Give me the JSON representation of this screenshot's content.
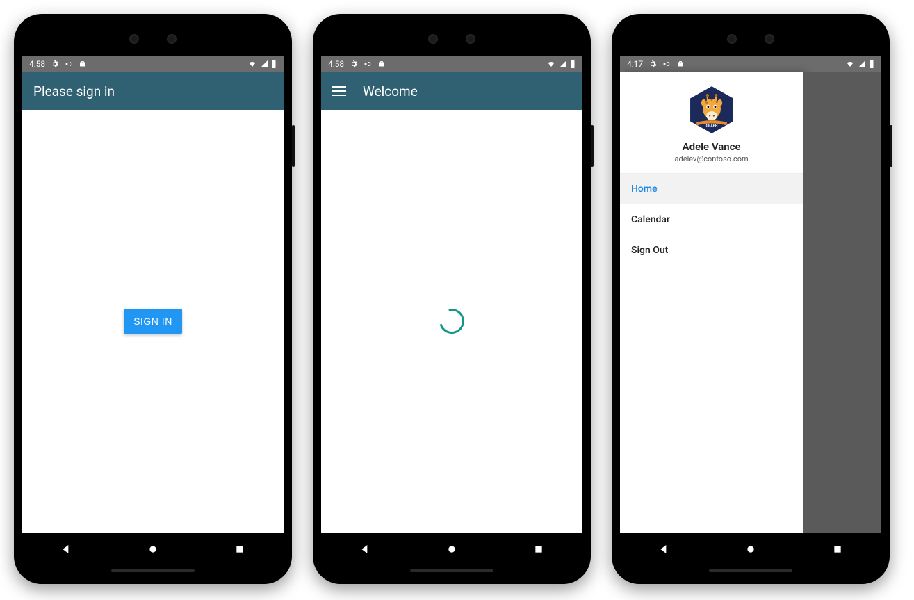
{
  "colors": {
    "appbar": "#2f6173",
    "appbar_dark": "#234a59",
    "primary_button": "#2196f3",
    "accent_active": "#1e88e5",
    "spinner": "#159688",
    "statusbar": "#6c6c6c"
  },
  "phone1": {
    "status": {
      "time": "4:58",
      "icons": [
        "gear-icon",
        "assistant-icon",
        "battery-icon"
      ],
      "right": [
        "wifi-icon",
        "signal-icon",
        "battery-full-icon"
      ]
    },
    "appbar": {
      "title": "Please sign in"
    },
    "signin": {
      "button_label": "SIGN IN"
    }
  },
  "phone2": {
    "status": {
      "time": "4:58",
      "icons": [
        "gear-icon",
        "assistant-icon",
        "battery-icon"
      ],
      "right": [
        "wifi-icon",
        "signal-icon",
        "battery-full-icon"
      ]
    },
    "appbar": {
      "title": "Welcome",
      "has_menu": true
    },
    "loading": true
  },
  "phone3": {
    "status": {
      "time": "4:17",
      "icons": [
        "gear-icon",
        "assistant-icon",
        "battery-icon"
      ],
      "right": [
        "wifi-icon",
        "signal-icon",
        "battery-full-icon"
      ]
    },
    "drawer": {
      "user": {
        "name": "Adele Vance",
        "email": "adelev@contoso.com",
        "avatar_label": "MICROSOFT GRAPH"
      },
      "items": [
        {
          "label": "Home",
          "active": true
        },
        {
          "label": "Calendar",
          "active": false
        },
        {
          "label": "Sign Out",
          "active": false
        }
      ]
    }
  }
}
